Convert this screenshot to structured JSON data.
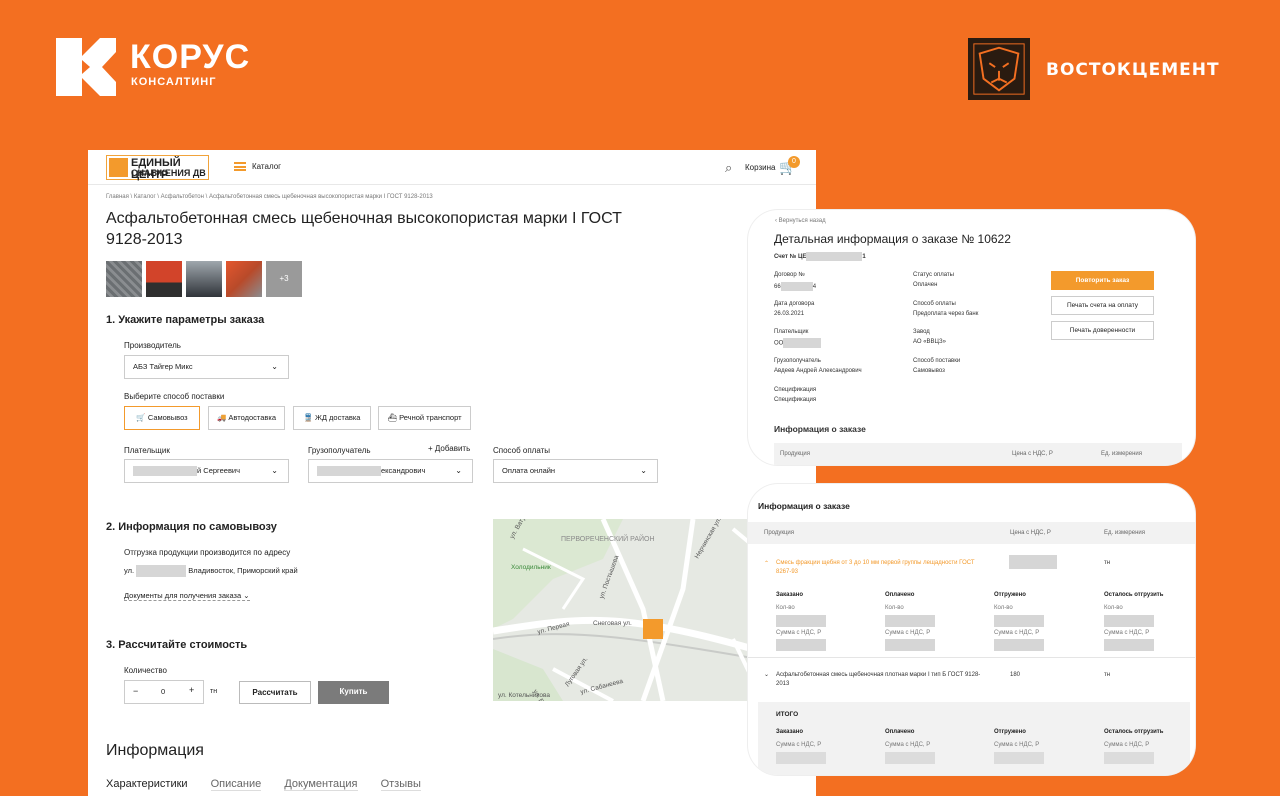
{
  "brand_left": {
    "title": "КОРУС",
    "subtitle": "КОНСАЛТИНГ"
  },
  "brand_right": {
    "title": "ВОСТОКЦЕМЕНТ"
  },
  "site": {
    "logo_line1": "ЕДИНЫЙ ЦЕНТР",
    "logo_line2": "СНАБЖЕНИЯ ДВ",
    "catalog": "Каталог",
    "cart": "Корзина",
    "cart_count": "0",
    "breadcrumb": "Главная \\ Каталог \\ Асфальтобетон \\ Асфальтобетонная смесь щебеночная высокопористая марки I ГОСТ 9128-2013",
    "title": "Асфальтобетонная смесь щебеночная высокопористая марки I ГОСТ 9128-2013",
    "thumb_more": "+3",
    "step1": "1.   Укажите параметры заказа",
    "manufacturer_label": "Производитель",
    "manufacturer_value": "АБЗ Тайгер Микс",
    "delivery_label": "Выберите способ поставки",
    "delivery_options": [
      "Самовывоз",
      "Автодоставка",
      "ЖД доставка",
      "Речной транспорт"
    ],
    "payer_label": "Плательщик",
    "payer_value": "й Сергеевич",
    "consignee_label": "Грузополучатель",
    "add_label": "+ Добавить",
    "consignee_value": "ександрович",
    "payment_label": "Способ оплаты",
    "payment_value": "Оплата онлайн",
    "step2": "2.   Информация по самовывозу",
    "pickup_note": "Отгрузка продукции производится по адресу",
    "address_prefix": "ул.",
    "address_rest": "Владивосток, Приморский край",
    "docs_link": "Документы для получения заказа",
    "step3": "3.   Рассчитайте стоимость",
    "qty_label": "Количество",
    "qty_value": "0",
    "unit": "тн",
    "calc_button": "Рассчитать",
    "buy_button": "Купить",
    "info_heading": "Информация",
    "tabs": [
      "Характеристики",
      "Описание",
      "Документация",
      "Отзывы"
    ],
    "map_labels": [
      "ПЕРВОРЕЧЕНСКИЙ РАЙОН",
      "Холодильник",
      "Снеговая ул.",
      "ул. Постышева",
      "ул. Первая",
      "Луговая ул.",
      "ул. Сабанеева",
      "Нерчинская ул.",
      "ул. Баляева",
      "ул. Котельникова",
      "ул. Ватутина"
    ]
  },
  "order_card": {
    "back": "‹  Вернуться назад",
    "title": "Детальная информация о заказе № 10622",
    "invoice_label": "Счет № ЦЕ",
    "invoice_suffix": "1",
    "contract_label": "Договор №",
    "contract_prefix": "66",
    "contract_suffix": "4",
    "contract_date_label": "Дата договора",
    "contract_date": "26.03.2021",
    "payer_label": "Плательщик",
    "payer_prefix": "ОО",
    "consignee_label": "Грузополучатель",
    "consignee_value": "Авдеев Андрей Александрович",
    "spec_label": "Спецификация",
    "spec_value": "Спецификация",
    "pay_status_label": "Статус оплаты",
    "pay_status": "Оплачен",
    "pay_method_label": "Способ оплаты",
    "pay_method": "Предоплата через банк",
    "plant_label": "Завод",
    "plant_value": "АО «ВВЦЗ»",
    "delivery_label": "Способ поставки",
    "delivery_value": "Самовывоз",
    "repeat_button": "Повторить заказ",
    "print_invoice_button": "Печать счета на оплату",
    "print_poa_button": "Печать доверенности",
    "info_heading": "Информация о заказе",
    "col_product": "Продукция",
    "col_price": "Цена с НДС, Р",
    "col_unit": "Ед. измерения"
  },
  "order_table": {
    "heading": "Информация о заказе",
    "col_product": "Продукция",
    "col_price": "Цена с НДС, Р",
    "col_unit": "Ед. измерения",
    "row1_product": "Смесь фракции щебня от 3 до 10 мм первой группы лещадности ГОСТ 8267-93",
    "row1_unit": "тн",
    "status_cols": [
      "Заказано",
      "Оплачено",
      "Отгружено",
      "Осталось отгрузить"
    ],
    "qty_label": "Кол-во",
    "sum_label": "Сумма с НДС, Р",
    "row2_product": "Асфальтобетонная смесь щебеночная плотная марки I тип Б ГОСТ 9128-2013",
    "row2_price": "180",
    "row2_unit": "тн",
    "total_label": "ИТОГО"
  },
  "colors": {
    "accent": "#f36f21",
    "site_accent": "#f39a2c"
  }
}
